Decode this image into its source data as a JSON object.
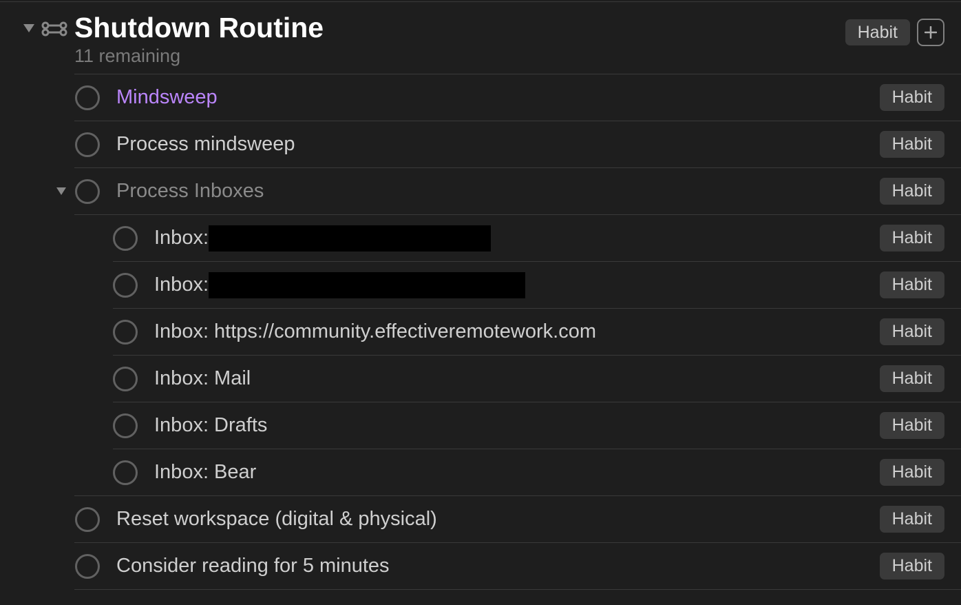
{
  "project": {
    "title": "Shutdown Routine",
    "subtitle": "11 remaining",
    "header_tag": "Habit"
  },
  "tasks": [
    {
      "title": "Mindsweep",
      "tag": "Habit",
      "style": "purple",
      "level": 0,
      "has_children": false,
      "redacted_width": 0,
      "sep_before": "full"
    },
    {
      "title": "Process mindsweep",
      "tag": "Habit",
      "style": "normal",
      "level": 0,
      "has_children": false,
      "redacted_width": 0,
      "sep_before": "full"
    },
    {
      "title": "Process Inboxes",
      "tag": "Habit",
      "style": "muted",
      "level": 0,
      "has_children": true,
      "redacted_width": 0,
      "sep_before": "full"
    },
    {
      "title": "Inbox: ",
      "tag": "Habit",
      "style": "normal",
      "level": 1,
      "has_children": false,
      "redacted_width": 410,
      "sep_before": "full"
    },
    {
      "title": "Inbox:",
      "tag": "Habit",
      "style": "normal",
      "level": 1,
      "has_children": false,
      "redacted_width": 460,
      "sep_before": "sub"
    },
    {
      "title": "Inbox: https://community.effectiveremotework.com",
      "tag": "Habit",
      "style": "normal",
      "level": 1,
      "has_children": false,
      "redacted_width": 0,
      "sep_before": "sub"
    },
    {
      "title": "Inbox: Mail",
      "tag": "Habit",
      "style": "normal",
      "level": 1,
      "has_children": false,
      "redacted_width": 0,
      "sep_before": "sub"
    },
    {
      "title": "Inbox: Drafts",
      "tag": "Habit",
      "style": "normal",
      "level": 1,
      "has_children": false,
      "redacted_width": 0,
      "sep_before": "sub"
    },
    {
      "title": "Inbox: Bear",
      "tag": "Habit",
      "style": "normal",
      "level": 1,
      "has_children": false,
      "redacted_width": 0,
      "sep_before": "sub"
    },
    {
      "title": "Reset workspace (digital & physical)",
      "tag": "Habit",
      "style": "normal",
      "level": 0,
      "has_children": false,
      "redacted_width": 0,
      "sep_before": "full"
    },
    {
      "title": "Consider reading for 5 minutes",
      "tag": "Habit",
      "style": "normal",
      "level": 0,
      "has_children": false,
      "redacted_width": 0,
      "sep_before": "full"
    }
  ]
}
